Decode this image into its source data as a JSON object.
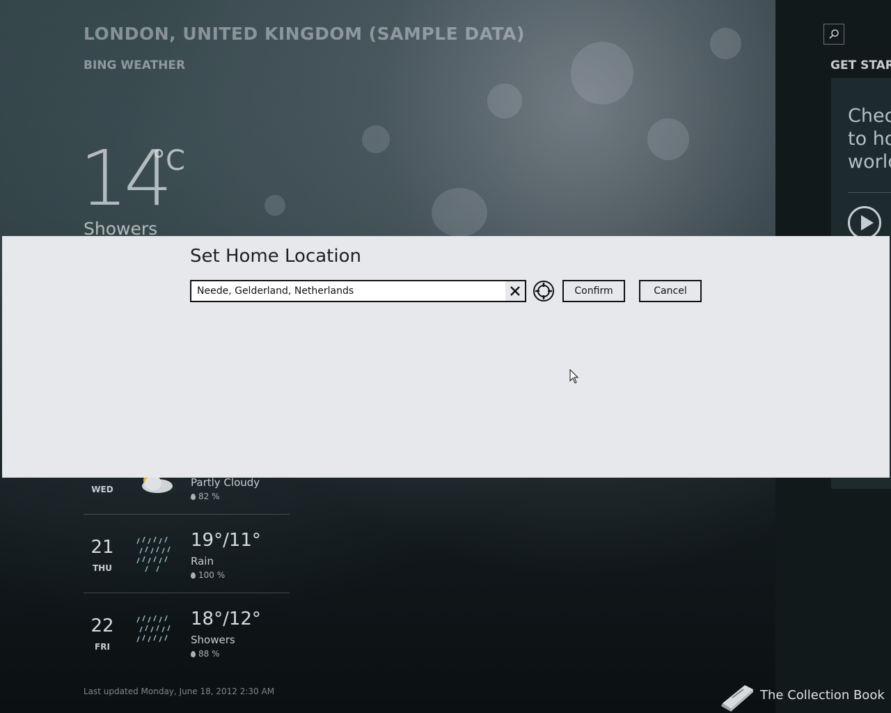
{
  "app": {
    "location_title": "LONDON, UNITED KINGDOM (SAMPLE DATA)",
    "app_name": "BING WEATHER"
  },
  "current": {
    "temperature": "14",
    "unit": "°C",
    "condition": "Showers"
  },
  "right_panel": {
    "section_title": "GET STARTED",
    "tile_text": "Chec\nto ho\nworld"
  },
  "forecast": [
    {
      "date": "",
      "day": "WED",
      "temps": "",
      "condition": "Partly Cloudy",
      "precip": "82 %",
      "icon": "partly-cloudy-icon"
    },
    {
      "date": "21",
      "day": "THU",
      "temps": "19°/11°",
      "condition": "Rain",
      "precip": "100 %",
      "icon": "rain-icon"
    },
    {
      "date": "22",
      "day": "FRI",
      "temps": "18°/12°",
      "condition": "Showers",
      "precip": "88 %",
      "icon": "showers-icon"
    }
  ],
  "footer": {
    "last_updated": "Last updated Monday, June 18, 2012 2:30 AM",
    "collection": "The Collection Book"
  },
  "dialog": {
    "title": "Set Home Location",
    "location_value": "Neede, Gelderland, Netherlands",
    "confirm_label": "Confirm",
    "cancel_label": "Cancel"
  }
}
